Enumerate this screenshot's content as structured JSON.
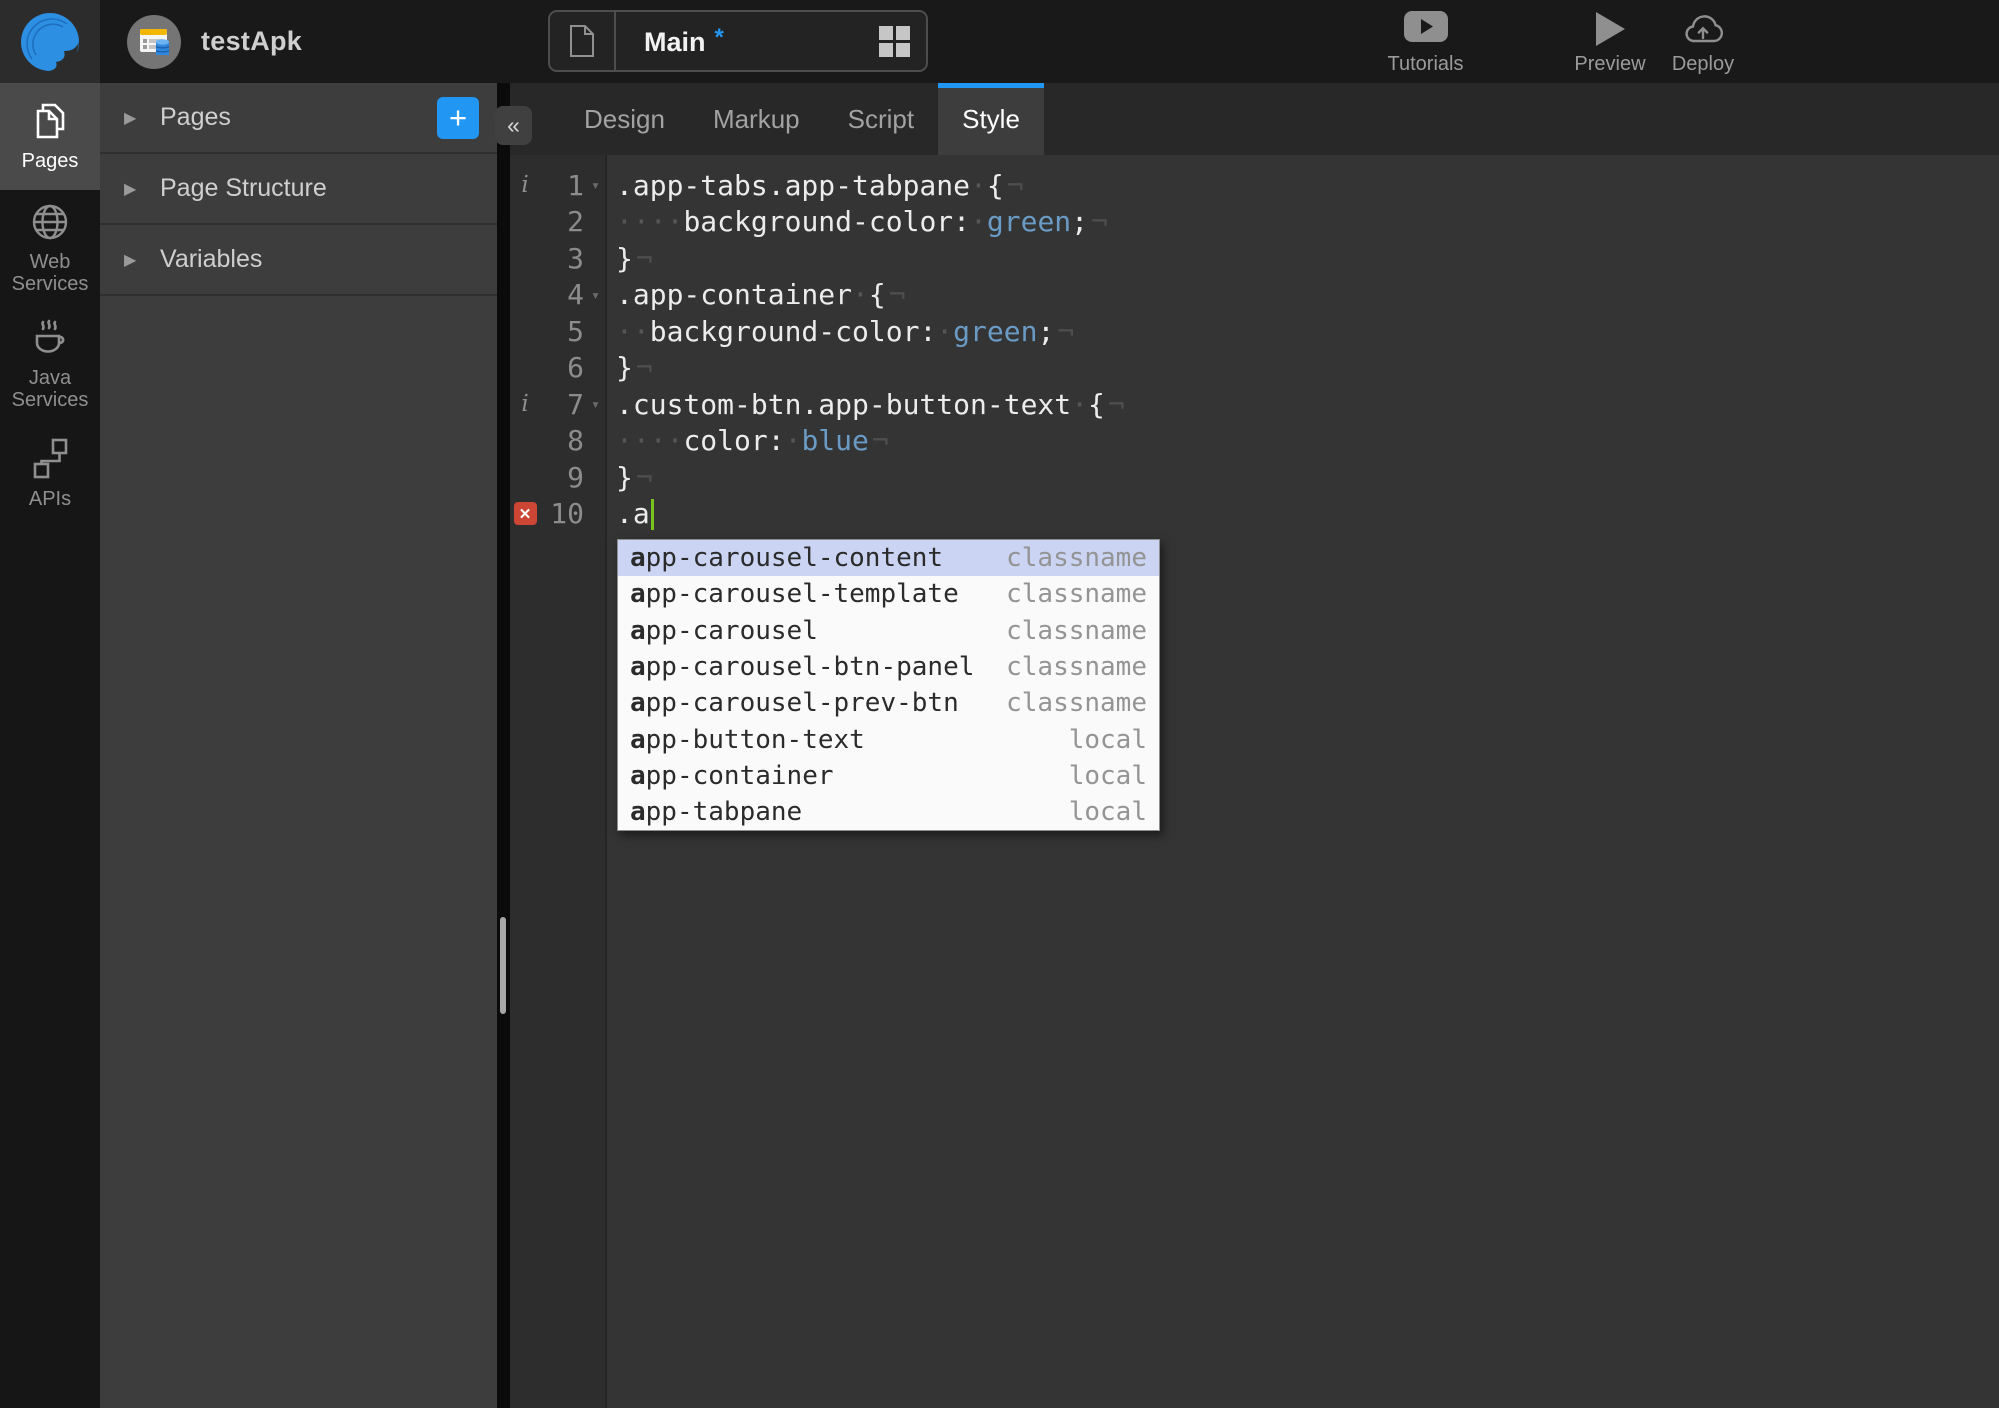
{
  "topbar": {
    "project_name": "testApk",
    "page_tab": {
      "label": "Main",
      "dirty": "*"
    },
    "actions": [
      {
        "id": "tutorials",
        "label": "Tutorials",
        "icon": "youtube-icon"
      },
      {
        "id": "preview",
        "label": "Preview",
        "icon": "play-icon"
      },
      {
        "id": "deploy",
        "label": "Deploy",
        "icon": "cloud-upload-icon"
      }
    ]
  },
  "sidebar": {
    "items": [
      {
        "id": "pages",
        "label": "Pages",
        "icon": "pages-icon",
        "active": true
      },
      {
        "id": "web-services",
        "label": "Web Services",
        "icon": "globe-icon",
        "active": false
      },
      {
        "id": "java-services",
        "label": "Java Services",
        "icon": "coffee-cup-icon",
        "active": false
      },
      {
        "id": "apis",
        "label": "APIs",
        "icon": "api-nodes-icon",
        "active": false
      }
    ]
  },
  "panel": {
    "collapse_icon": "«",
    "add_label": "+",
    "sections": [
      {
        "id": "pages",
        "label": "Pages",
        "has_add": true
      },
      {
        "id": "page-structure",
        "label": "Page Structure",
        "has_add": false
      },
      {
        "id": "variables",
        "label": "Variables",
        "has_add": false
      }
    ]
  },
  "editor": {
    "tabs": [
      {
        "label": "Design",
        "active": false
      },
      {
        "label": "Markup",
        "active": false
      },
      {
        "label": "Script",
        "active": false
      },
      {
        "label": "Style",
        "active": true
      }
    ],
    "marks": {
      "info": "i",
      "error": "✕",
      "fold": "▾",
      "eol": "¬"
    },
    "lines": [
      {
        "num": "1",
        "info": true,
        "fold": true,
        "eol": true,
        "cursor": false,
        "seg": [
          {
            "c": "t",
            "t": ".app-tabs.app-tabpane"
          },
          {
            "c": "w",
            "t": " "
          },
          {
            "c": "t",
            "t": "{"
          }
        ]
      },
      {
        "num": "2",
        "info": false,
        "fold": false,
        "eol": true,
        "cursor": false,
        "seg": [
          {
            "c": "w",
            "t": "    "
          },
          {
            "c": "t",
            "t": "background-color:"
          },
          {
            "c": "w",
            "t": " "
          },
          {
            "c": "v",
            "t": "green"
          },
          {
            "c": "t",
            "t": ";"
          }
        ]
      },
      {
        "num": "3",
        "info": false,
        "fold": false,
        "eol": true,
        "cursor": false,
        "seg": [
          {
            "c": "t",
            "t": "}"
          }
        ]
      },
      {
        "num": "4",
        "info": false,
        "fold": true,
        "eol": true,
        "cursor": false,
        "seg": [
          {
            "c": "t",
            "t": ".app-container"
          },
          {
            "c": "w",
            "t": " "
          },
          {
            "c": "t",
            "t": "{"
          }
        ]
      },
      {
        "num": "5",
        "info": false,
        "fold": false,
        "eol": true,
        "cursor": false,
        "seg": [
          {
            "c": "w",
            "t": "  "
          },
          {
            "c": "t",
            "t": "background-color:"
          },
          {
            "c": "w",
            "t": " "
          },
          {
            "c": "v",
            "t": "green"
          },
          {
            "c": "t",
            "t": ";"
          }
        ]
      },
      {
        "num": "6",
        "info": false,
        "fold": false,
        "eol": true,
        "cursor": false,
        "seg": [
          {
            "c": "t",
            "t": "}"
          }
        ]
      },
      {
        "num": "7",
        "info": true,
        "fold": true,
        "eol": true,
        "cursor": false,
        "seg": [
          {
            "c": "t",
            "t": ".custom-btn.app-button-text"
          },
          {
            "c": "w",
            "t": " "
          },
          {
            "c": "t",
            "t": "{"
          }
        ]
      },
      {
        "num": "8",
        "info": false,
        "fold": false,
        "eol": true,
        "cursor": false,
        "seg": [
          {
            "c": "w",
            "t": "    "
          },
          {
            "c": "t",
            "t": "color:"
          },
          {
            "c": "w",
            "t": " "
          },
          {
            "c": "v",
            "t": "blue"
          }
        ]
      },
      {
        "num": "9",
        "info": false,
        "fold": false,
        "eol": true,
        "cursor": false,
        "seg": [
          {
            "c": "t",
            "t": "}"
          }
        ]
      },
      {
        "num": "10",
        "info": false,
        "fold": false,
        "eol": false,
        "cursor": true,
        "error": true,
        "seg": [
          {
            "c": "t",
            "t": ".a"
          }
        ]
      }
    ]
  },
  "autocomplete": {
    "match_prefix": "a",
    "items": [
      {
        "name": "app-carousel-content",
        "type": "classname",
        "selected": true
      },
      {
        "name": "app-carousel-template",
        "type": "classname",
        "selected": false
      },
      {
        "name": "app-carousel",
        "type": "classname",
        "selected": false
      },
      {
        "name": "app-carousel-btn-panel",
        "type": "classname",
        "selected": false
      },
      {
        "name": "app-carousel-prev-btn",
        "type": "classname",
        "selected": false
      },
      {
        "name": "app-button-text",
        "type": "local",
        "selected": false
      },
      {
        "name": "app-container",
        "type": "local",
        "selected": false
      },
      {
        "name": "app-tabpane",
        "type": "local",
        "selected": false
      }
    ]
  },
  "colors": {
    "accent_blue": "#2196f3",
    "css_value_blue": "#6a9bc5",
    "cursor_green": "#7ac31c",
    "error_red": "#cd4535",
    "autocomplete_selected": "#cbd5f3",
    "panel_gray": "#3d3d3d",
    "editor_bg": "#343434"
  }
}
